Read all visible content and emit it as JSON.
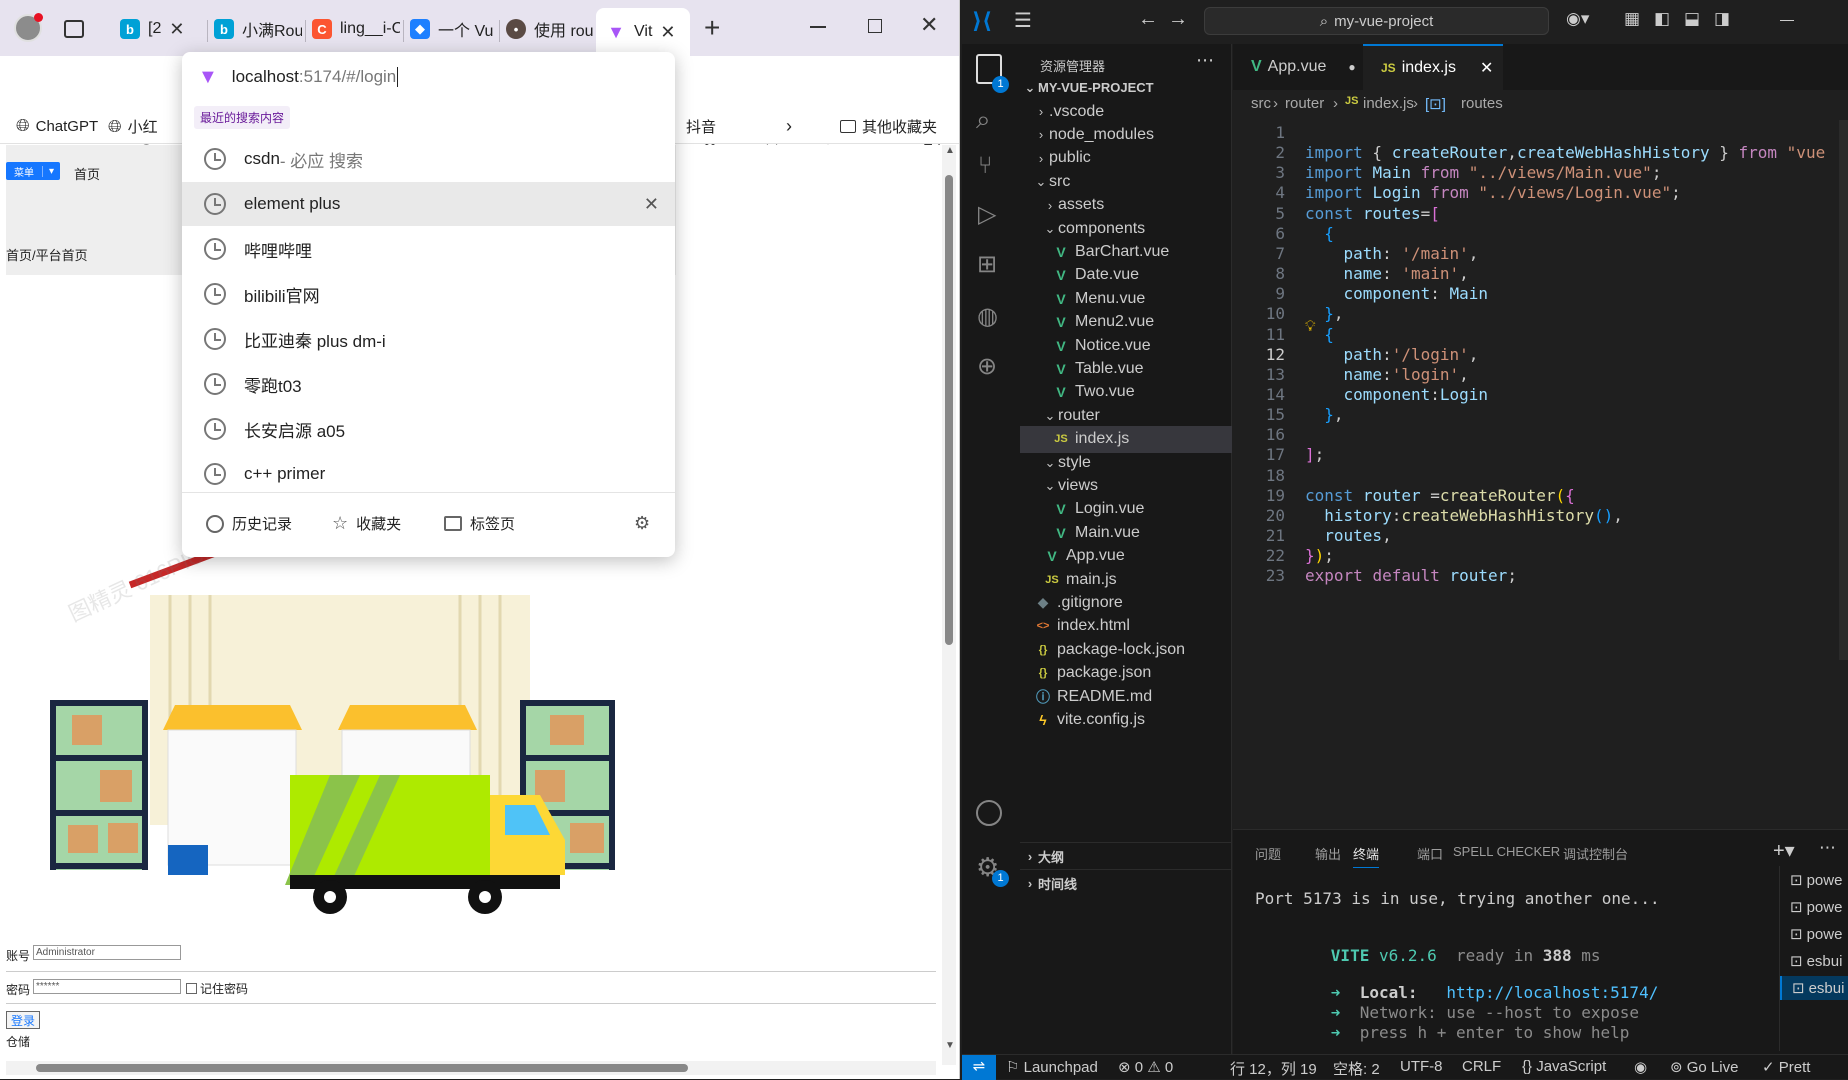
{
  "browser": {
    "tabs": [
      {
        "label": "[2",
        "icon": "bilibili-icon"
      },
      {
        "label": "小满Rou",
        "icon": "bilibili-icon"
      },
      {
        "label": "ling__i-C",
        "icon": "csdn-icon"
      },
      {
        "label": "一个 Vu",
        "icon": "juejin-icon"
      },
      {
        "label": "使用 rou",
        "icon": "avatar-icon"
      },
      {
        "label": "Vit",
        "icon": "vite-icon"
      }
    ],
    "bookmarks": [
      "ChatGPT",
      "小红",
      "抖音",
      "其他收藏夹"
    ],
    "address": {
      "host": "localhost",
      "rest": ":5174/#/login"
    },
    "omnibox": {
      "recent_label": "最近的搜索内容",
      "items": [
        {
          "text": "csdn",
          "hint": " - 必应 搜索"
        },
        {
          "text": "element plus",
          "hint": ""
        },
        {
          "text": "哔哩哔哩",
          "hint": ""
        },
        {
          "text": "bilibili官网",
          "hint": ""
        },
        {
          "text": "比亚迪秦 plus dm-i",
          "hint": ""
        },
        {
          "text": "零跑t03",
          "hint": ""
        },
        {
          "text": "长安启源 a05",
          "hint": ""
        },
        {
          "text": "c++ primer",
          "hint": ""
        }
      ],
      "footer": [
        "历史记录",
        "收藏夹",
        "标签页"
      ]
    },
    "page": {
      "menu_button": "菜单",
      "home_link": "首页",
      "breadcrumb": "首页/平台首页",
      "account_label": "账号",
      "account_value": "Administrator",
      "password_label": "密码",
      "password_value": "******",
      "remember_label": "记住密码",
      "login_button": "登录",
      "footer_text": "仓储",
      "watermark": "图精灵 616PIC.COM"
    }
  },
  "vscode": {
    "search": "my-vue-project",
    "explorer_title": "资源管理器",
    "project": "MY-VUE-PROJECT",
    "tree": [
      {
        "label": ".vscode",
        "kind": "folder",
        "depth": 1,
        "open": false
      },
      {
        "label": "node_modules",
        "kind": "folder",
        "depth": 1,
        "open": false
      },
      {
        "label": "public",
        "kind": "folder",
        "depth": 1,
        "open": false
      },
      {
        "label": "src",
        "kind": "folder",
        "depth": 1,
        "open": true
      },
      {
        "label": "assets",
        "kind": "folder",
        "depth": 2,
        "open": false
      },
      {
        "label": "components",
        "kind": "folder",
        "depth": 2,
        "open": true
      },
      {
        "label": "BarChart.vue",
        "kind": "vue",
        "depth": 3
      },
      {
        "label": "Date.vue",
        "kind": "vue",
        "depth": 3
      },
      {
        "label": "Menu.vue",
        "kind": "vue",
        "depth": 3
      },
      {
        "label": "Menu2.vue",
        "kind": "vue",
        "depth": 3
      },
      {
        "label": "Notice.vue",
        "kind": "vue",
        "depth": 3
      },
      {
        "label": "Table.vue",
        "kind": "vue",
        "depth": 3
      },
      {
        "label": "Two.vue",
        "kind": "vue",
        "depth": 3
      },
      {
        "label": "router",
        "kind": "folder",
        "depth": 2,
        "open": true
      },
      {
        "label": "index.js",
        "kind": "js",
        "depth": 3,
        "selected": true
      },
      {
        "label": "style",
        "kind": "folder",
        "depth": 2,
        "open": true
      },
      {
        "label": "views",
        "kind": "folder",
        "depth": 2,
        "open": true
      },
      {
        "label": "Login.vue",
        "kind": "vue",
        "depth": 3
      },
      {
        "label": "Main.vue",
        "kind": "vue",
        "depth": 3
      },
      {
        "label": "App.vue",
        "kind": "vue",
        "depth": 2
      },
      {
        "label": "main.js",
        "kind": "js",
        "depth": 2
      },
      {
        "label": ".gitignore",
        "kind": "git",
        "depth": 1
      },
      {
        "label": "index.html",
        "kind": "html",
        "depth": 1
      },
      {
        "label": "package-lock.json",
        "kind": "json",
        "depth": 1
      },
      {
        "label": "package.json",
        "kind": "json",
        "depth": 1
      },
      {
        "label": "README.md",
        "kind": "info",
        "depth": 1
      },
      {
        "label": "vite.config.js",
        "kind": "vite",
        "depth": 1
      }
    ],
    "outline": "大纲",
    "timeline": "时间线",
    "tabs": [
      {
        "label": "App.vue",
        "kind": "vue",
        "modified": true
      },
      {
        "label": "index.js",
        "kind": "js",
        "active": true
      }
    ],
    "breadcrumbs": [
      "src",
      "router",
      "index.js",
      "routes"
    ],
    "current_line": 12,
    "code": [
      [],
      [
        [
          "k",
          "import"
        ],
        [
          "t",
          " { "
        ],
        [
          "v",
          "createRouter"
        ],
        [
          "t",
          ","
        ],
        [
          "v",
          "createWebHashHistory"
        ],
        [
          "t",
          " } "
        ],
        [
          "kw",
          "from"
        ],
        [
          "t",
          " "
        ],
        [
          "s",
          "\"vue"
        ]
      ],
      [
        [
          "k",
          "import"
        ],
        [
          "t",
          " "
        ],
        [
          "v",
          "Main"
        ],
        [
          "t",
          " "
        ],
        [
          "kw",
          "from"
        ],
        [
          "t",
          " "
        ],
        [
          "s",
          "\"../views/Main.vue\""
        ],
        [
          "t",
          ";"
        ]
      ],
      [
        [
          "k",
          "import"
        ],
        [
          "t",
          " "
        ],
        [
          "v",
          "Login"
        ],
        [
          "t",
          " "
        ],
        [
          "kw",
          "from"
        ],
        [
          "t",
          " "
        ],
        [
          "s",
          "\"../views/Login.vue\""
        ],
        [
          "t",
          ";"
        ]
      ],
      [
        [
          "k",
          "const"
        ],
        [
          "t",
          " "
        ],
        [
          "v",
          "routes"
        ],
        [
          "t",
          "="
        ],
        [
          "pp",
          "["
        ]
      ],
      [
        [
          "t",
          "  "
        ],
        [
          "bb",
          "{"
        ]
      ],
      [
        [
          "t",
          "    "
        ],
        [
          "v",
          "path"
        ],
        [
          "t",
          ": "
        ],
        [
          "s",
          "'/main'"
        ],
        [
          "t",
          ","
        ]
      ],
      [
        [
          "t",
          "    "
        ],
        [
          "v",
          "name"
        ],
        [
          "t",
          ": "
        ],
        [
          "s",
          "'main'"
        ],
        [
          "t",
          ","
        ]
      ],
      [
        [
          "t",
          "    "
        ],
        [
          "v",
          "component"
        ],
        [
          "t",
          ": "
        ],
        [
          "v",
          "Main"
        ]
      ],
      [
        [
          "t",
          "  "
        ],
        [
          "bb",
          "}"
        ],
        [
          "t",
          ","
        ]
      ],
      [
        [
          "t",
          "  "
        ],
        [
          "bb",
          "{"
        ]
      ],
      [
        [
          "t",
          "    "
        ],
        [
          "v",
          "path"
        ],
        [
          "t",
          ":"
        ],
        [
          "s",
          "'/login'"
        ],
        [
          "t",
          ","
        ]
      ],
      [
        [
          "t",
          "    "
        ],
        [
          "v",
          "name"
        ],
        [
          "t",
          ":"
        ],
        [
          "s",
          "'login'"
        ],
        [
          "t",
          ","
        ]
      ],
      [
        [
          "t",
          "    "
        ],
        [
          "v",
          "component"
        ],
        [
          "t",
          ":"
        ],
        [
          "v",
          "Login"
        ]
      ],
      [
        [
          "t",
          "  "
        ],
        [
          "bb",
          "}"
        ],
        [
          "t",
          ","
        ]
      ],
      [],
      [
        [
          "pp",
          "]"
        ],
        [
          "t",
          ";"
        ]
      ],
      [],
      [
        [
          "k",
          "const"
        ],
        [
          "t",
          " "
        ],
        [
          "v",
          "router"
        ],
        [
          "t",
          " ="
        ],
        [
          "f",
          "createRouter"
        ],
        [
          "p",
          "("
        ],
        [
          "pp",
          "{"
        ]
      ],
      [
        [
          "t",
          "  "
        ],
        [
          "v",
          "history"
        ],
        [
          "t",
          ":"
        ],
        [
          "f",
          "createWebHashHistory"
        ],
        [
          "bb",
          "()"
        ],
        [
          "t",
          ","
        ]
      ],
      [
        [
          "t",
          "  "
        ],
        [
          "v",
          "routes"
        ],
        [
          "t",
          ","
        ]
      ],
      [
        [
          "pp",
          "}"
        ],
        [
          "p",
          ")"
        ],
        [
          "t",
          ";"
        ]
      ],
      [
        [
          "kw",
          "export"
        ],
        [
          "t",
          " "
        ],
        [
          "kw",
          "default"
        ],
        [
          "t",
          " "
        ],
        [
          "v",
          "router"
        ],
        [
          "t",
          ";"
        ]
      ]
    ],
    "panel_tabs": [
      "问题",
      "输出",
      "终端",
      "端口",
      "SPELL CHECKER",
      "调试控制台"
    ],
    "active_panel": "终端",
    "terminal": {
      "line1": "Port 5173 is in use, trying another one...",
      "vite": "VITE",
      "version": " v6.2.6",
      "ready": "  ready in ",
      "ms": "388",
      "ms_unit": " ms",
      "local_label": "Local:",
      "local_url": "http://localhost:5174/",
      "network_label": "Network:",
      "network_text": " use --host to expose",
      "help_text": "press h + enter to show help"
    },
    "term_list": [
      "powe",
      "powe",
      "powe",
      "esbui",
      "esbui"
    ],
    "status": {
      "launchpad": "Launchpad",
      "errors": "0",
      "warnings": "0",
      "position": "行 12，列 19",
      "spaces": "空格: 2",
      "encoding": "UTF-8",
      "eol": "CRLF",
      "language": "JavaScript",
      "golive": "Go Live",
      "prettier": "Prett"
    },
    "colors": {
      "accent": "#0078d4",
      "vue": "#41b883",
      "js": "#cbcb41"
    }
  }
}
